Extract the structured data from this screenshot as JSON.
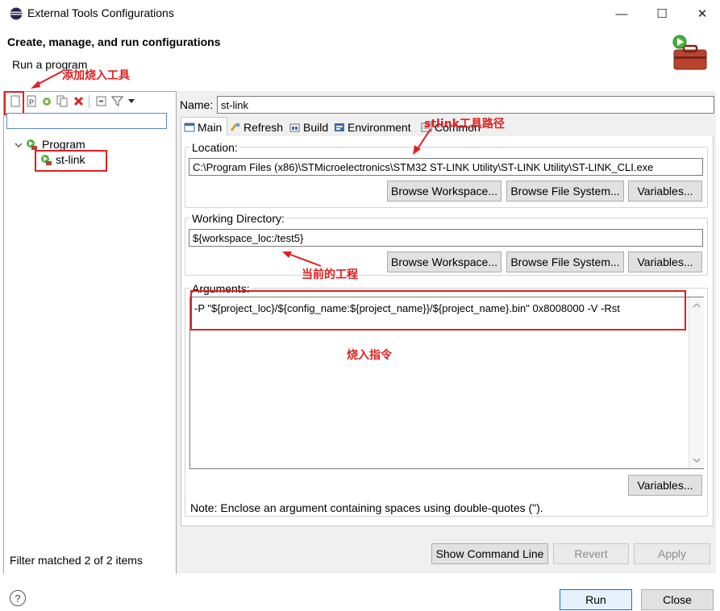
{
  "window": {
    "title": "External Tools Configurations",
    "minimize": "—",
    "maximize": "☐",
    "close": "✕"
  },
  "header": {
    "title": "Create, manage, and run configurations",
    "subtitle": "Run a program"
  },
  "left_panel": {
    "filter_value": "",
    "tree": [
      {
        "label": "Program",
        "expanded": true
      },
      {
        "label": "st-link"
      }
    ],
    "status": "Filter matched 2 of 2 items"
  },
  "config": {
    "name_label": "Name:",
    "name_value": "st-link",
    "tabs": [
      "Main",
      "Refresh",
      "Build",
      "Environment",
      "Common"
    ],
    "location": {
      "label": "Location:",
      "value": "C:\\Program Files (x86)\\STMicroelectronics\\STM32 ST-LINK Utility\\ST-LINK Utility\\ST-LINK_CLI.exe"
    },
    "working_dir": {
      "label": "Working Directory:",
      "value": "${workspace_loc:/test5}"
    },
    "arguments": {
      "label": "Arguments:",
      "value": "-P \"${project_loc}/${config_name:${project_name}}/${project_name}.bin\"  0x8008000 -V -Rst"
    },
    "buttons": {
      "browse_workspace": "Browse Workspace...",
      "browse_fs": "Browse File System...",
      "variables": "Variables..."
    },
    "note": "Note: Enclose an argument containing spaces using double-quotes (\")."
  },
  "actions": {
    "show_command_line": "Show Command Line",
    "revert": "Revert",
    "apply": "Apply",
    "run": "Run",
    "close": "Close",
    "help": "?"
  },
  "annotations": {
    "add_tool": "添加烧入工具",
    "stlink_path": "stlink工具路径",
    "current_project": "当前的工程",
    "burn_command": "烧入指令"
  },
  "colors": {
    "accent_red": "#e02020",
    "focus_blue": "#5a88d8",
    "run_border": "#3c7fb1"
  }
}
